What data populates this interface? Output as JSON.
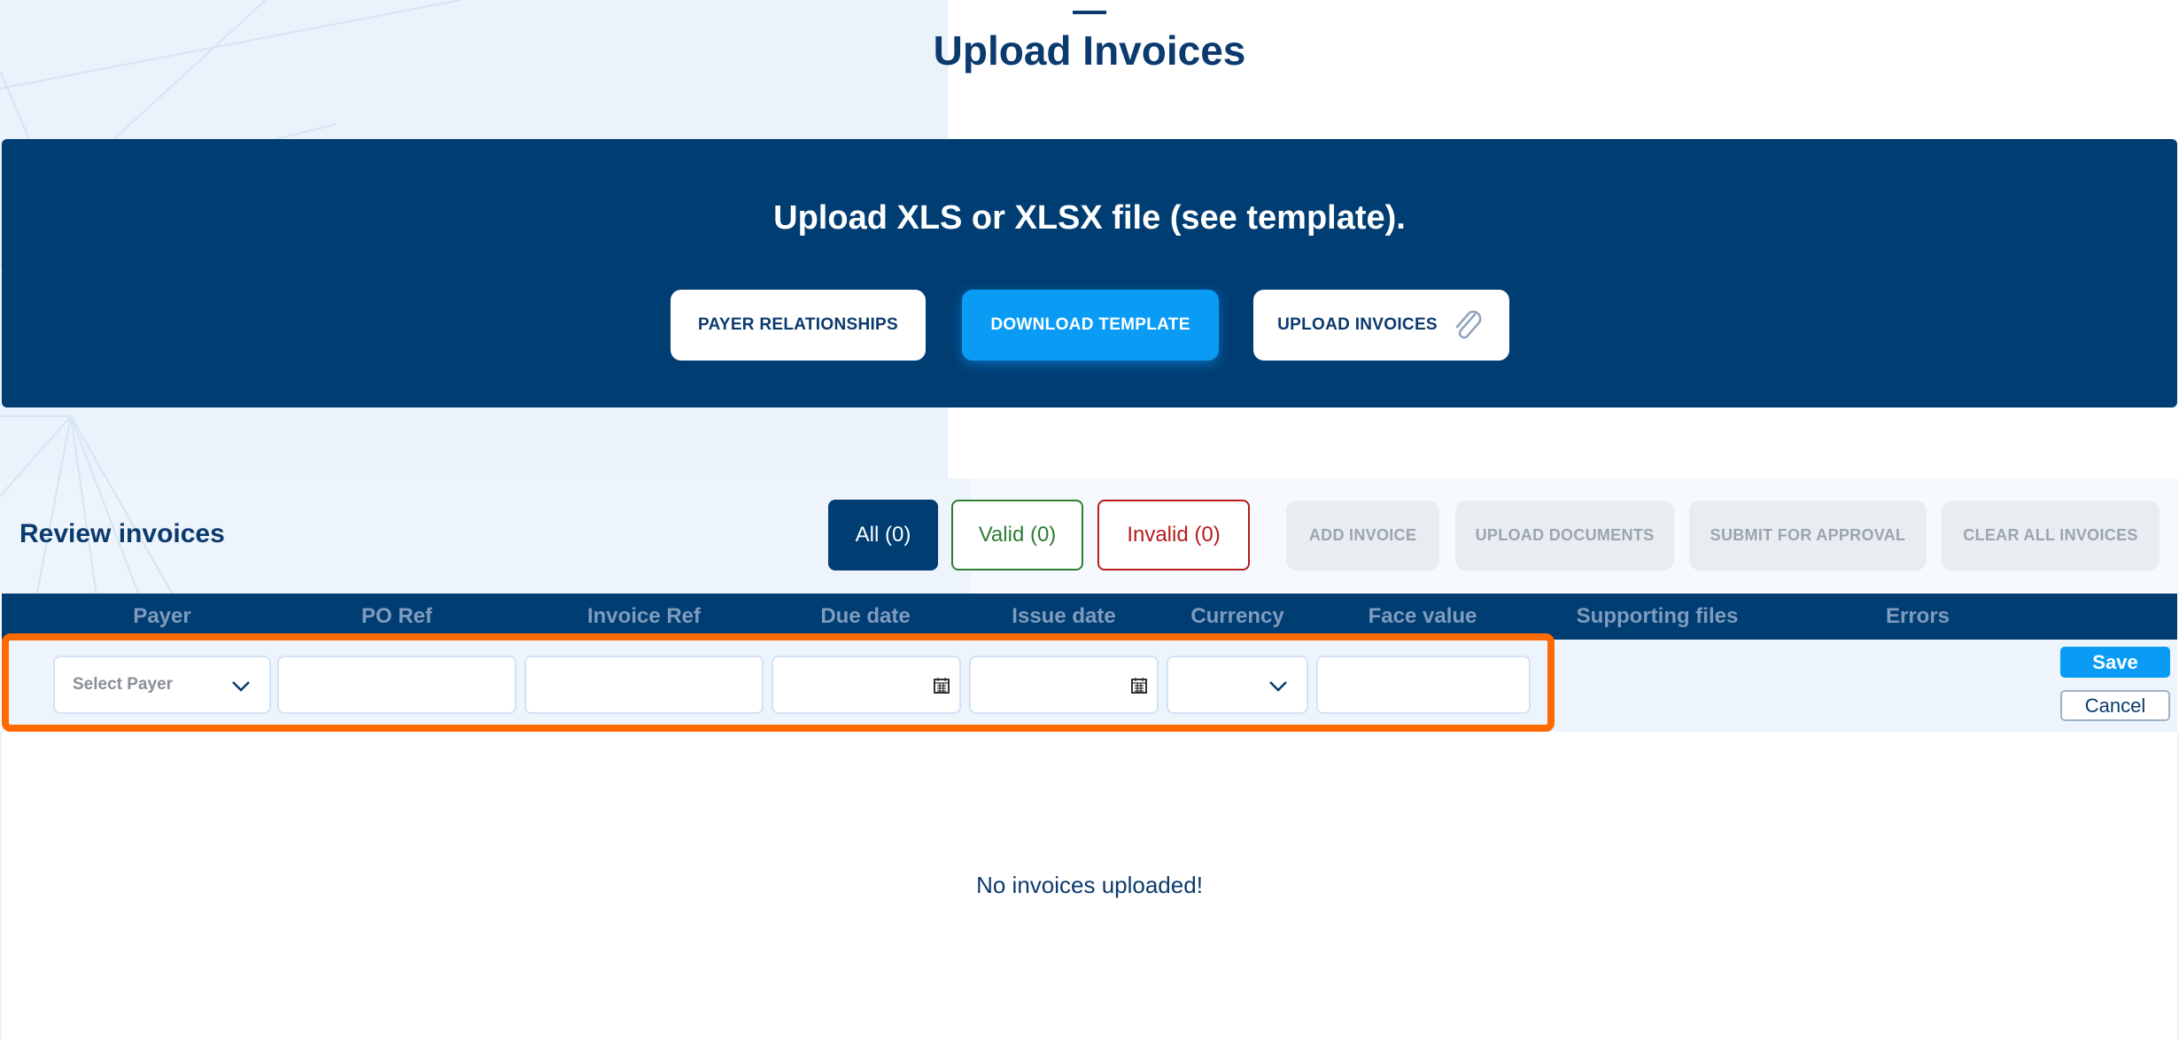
{
  "page": {
    "title": "Upload Invoices"
  },
  "hero": {
    "heading": "Upload XLS or XLSX file (see template).",
    "buttons": {
      "payer_relationships": "PAYER RELATIONSHIPS",
      "download_template": "DOWNLOAD TEMPLATE",
      "upload_invoices": "UPLOAD INVOICES"
    },
    "upload_icon": "paperclip-icon"
  },
  "review": {
    "title": "Review invoices",
    "filters": {
      "all": "All (0)",
      "valid": "Valid (0)",
      "invalid": "Invalid (0)"
    },
    "actions": {
      "add_invoice": "ADD INVOICE",
      "upload_documents": "UPLOAD DOCUMENTS",
      "submit_for_approval": "SUBMIT FOR APPROVAL",
      "clear_all": "CLEAR ALL INVOICES"
    }
  },
  "table": {
    "columns": [
      "Payer",
      "PO Ref",
      "Invoice Ref",
      "Due date",
      "Issue date",
      "Currency",
      "Face value",
      "Supporting files",
      "Errors"
    ]
  },
  "edit_row": {
    "payer_placeholder": "Select Payer",
    "po_ref": "",
    "invoice_ref": "",
    "due_date": "",
    "issue_date": "",
    "currency": "",
    "face_value": "",
    "save_label": "Save",
    "cancel_label": "Cancel"
  },
  "empty_message": "No invoices uploaded!",
  "colors": {
    "navy": "#003d73",
    "accent_blue": "#0a9cf5",
    "highlight": "#ff6a00",
    "valid": "#2e7d32",
    "invalid": "#b71c1c"
  }
}
